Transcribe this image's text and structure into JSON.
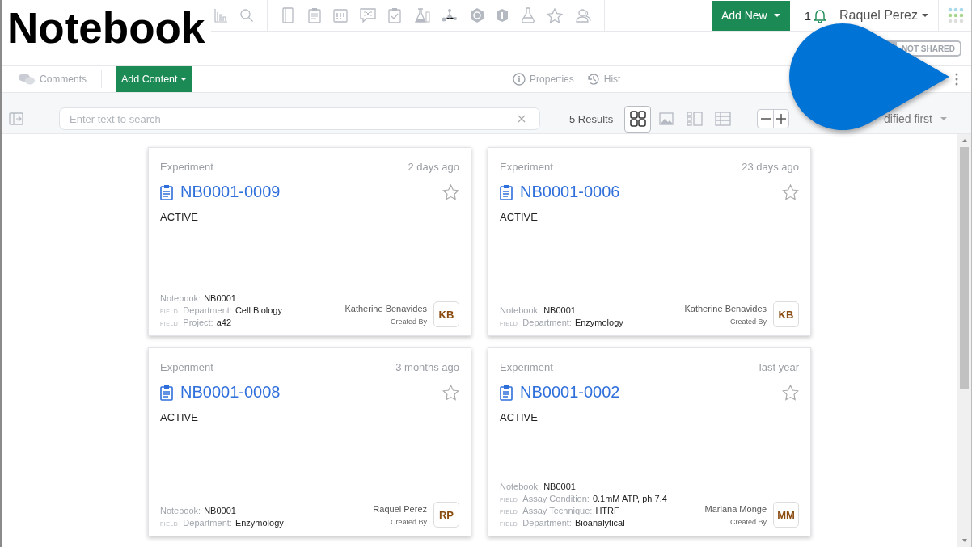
{
  "overlay_label": "Notebook",
  "top_nav": {
    "add_new": "Add New",
    "notification_count": "1",
    "user": "Raquel Perez"
  },
  "sharing": {
    "label": "NOT SHARED",
    "shared": false
  },
  "action_bar": {
    "comments": "Comments",
    "add_content": "Add Content",
    "properties": "Properties",
    "history": "Hist"
  },
  "toolbar": {
    "search_placeholder": "Enter text to search",
    "results": "5 Results",
    "views": [
      {
        "kind": "grid",
        "selected": true
      },
      {
        "kind": "image",
        "selected": false
      },
      {
        "kind": "list",
        "selected": false
      },
      {
        "kind": "table",
        "selected": false
      }
    ],
    "sort": "dified first"
  },
  "cards": [
    {
      "type": "Experiment",
      "time": "2 days ago",
      "title": "NB0001-0009",
      "status": "ACTIVE",
      "fields": [
        {
          "label": "Notebook:",
          "value": "NB0001"
        },
        {
          "tag": "FIELD",
          "label": "Department:",
          "value": "Cell Biology"
        },
        {
          "tag": "FIELD",
          "label": "Project:",
          "value": "a42"
        }
      ],
      "creator": "Katherine Benavides",
      "creator_label": "Created By",
      "initials": "KB"
    },
    {
      "type": "Experiment",
      "time": "23 days ago",
      "title": "NB0001-0006",
      "status": "ACTIVE",
      "fields": [
        {
          "label": "Notebook:",
          "value": "NB0001"
        },
        {
          "tag": "FIELD",
          "label": "Department:",
          "value": "Enzymology"
        }
      ],
      "creator": "Katherine Benavides",
      "creator_label": "Created By",
      "initials": "KB"
    },
    {
      "type": "Experiment",
      "time": "3 months ago",
      "title": "NB0001-0008",
      "status": "ACTIVE",
      "fields": [
        {
          "label": "Notebook:",
          "value": "NB0001"
        },
        {
          "tag": "FIELD",
          "label": "Department:",
          "value": "Enzymology"
        }
      ],
      "creator": "Raquel Perez",
      "creator_label": "Created By",
      "initials": "RP"
    },
    {
      "type": "Experiment",
      "time": "last year",
      "title": "NB0001-0002",
      "status": "ACTIVE",
      "fields": [
        {
          "label": "Notebook:",
          "value": "NB0001"
        },
        {
          "tag": "FIELD",
          "label": "Assay Condition:",
          "value": "0.1mM ATP, ph 7.4"
        },
        {
          "tag": "FIELD",
          "label": "Assay Technique:",
          "value": "HTRF"
        },
        {
          "tag": "FIELD",
          "label": "Department:",
          "value": "Bioanalytical"
        }
      ],
      "creator": "Mariana Monge",
      "creator_label": "Created By",
      "initials": "MM"
    }
  ]
}
